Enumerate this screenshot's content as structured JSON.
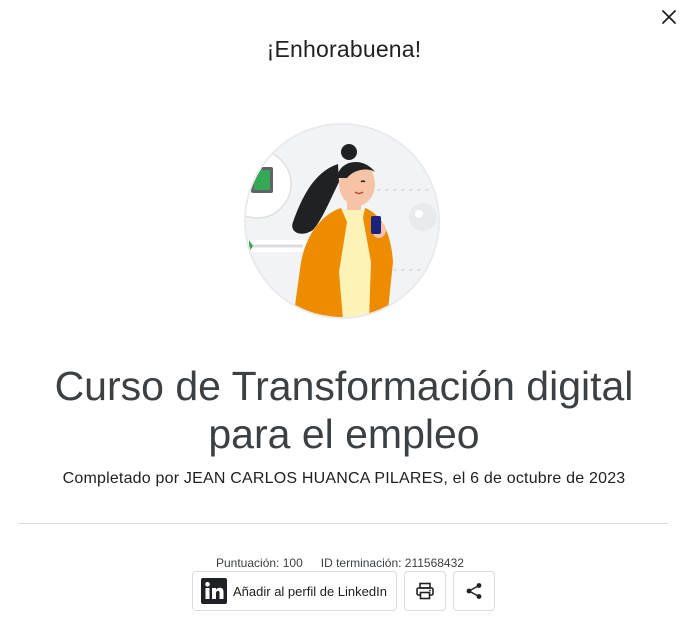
{
  "dialog": {
    "title": "¡Enhorabuena!",
    "close_icon": "close-icon"
  },
  "course": {
    "title_line1": "Curso de Transformación digital",
    "title_line2": "para el empleo",
    "completed_by": "Completado por JEAN CARLOS HUANCA PILARES, el 6 de octubre de 2023"
  },
  "meta": {
    "score": "Puntuación: 100",
    "completion_id": "ID terminación: 211568432"
  },
  "actions": {
    "linkedin_label": "Añadir al perfil de LinkedIn",
    "linkedin_icon": "linkedin-icon",
    "print_icon": "print-icon",
    "share_icon": "share-icon"
  },
  "colors": {
    "jacket": "#ee8c00",
    "shirt": "#fdf2b8",
    "hair": "#202124",
    "skin": "#f6c3a6",
    "divider": "#dadce0"
  }
}
